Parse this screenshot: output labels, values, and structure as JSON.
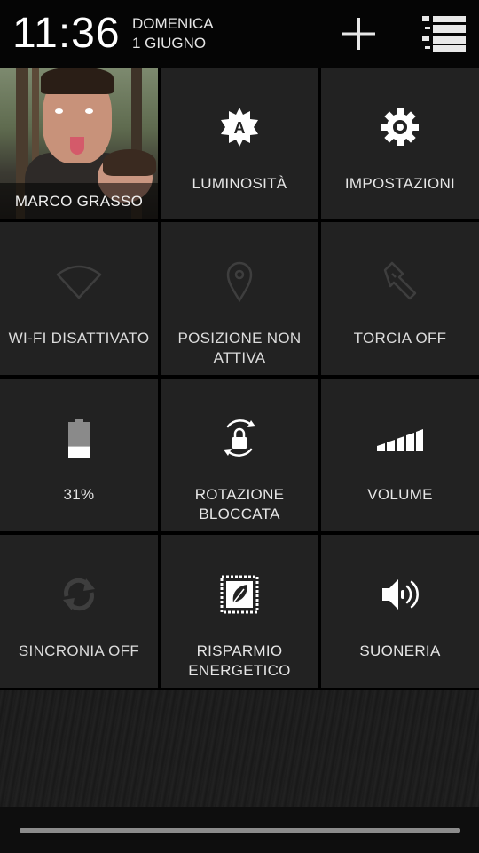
{
  "status": {
    "time": "11:36",
    "day": "DOMENICA",
    "date": "1 GIUGNO"
  },
  "header": {
    "add_icon": "plus-icon",
    "list_icon": "settings-list-icon"
  },
  "tiles": [
    {
      "label": "MARCO GRASSO",
      "icon": "user-photo",
      "state": "on"
    },
    {
      "label": "LUMINOSITÀ",
      "icon": "brightness-auto-icon",
      "state": "on"
    },
    {
      "label": "IMPOSTAZIONI",
      "icon": "gear-icon",
      "state": "on"
    },
    {
      "label": "WI-FI DISATTIVATO",
      "icon": "wifi-icon",
      "state": "off"
    },
    {
      "label": "POSIZIONE NON ATTIVA",
      "icon": "location-pin-icon",
      "state": "off"
    },
    {
      "label": "TORCIA OFF",
      "icon": "flashlight-icon",
      "state": "off"
    },
    {
      "label": "31%",
      "icon": "battery-icon",
      "state": "on",
      "level": 0.31
    },
    {
      "label": "ROTAZIONE BLOCCATA",
      "icon": "rotation-lock-icon",
      "state": "on"
    },
    {
      "label": "VOLUME",
      "icon": "volume-bars-icon",
      "state": "on"
    },
    {
      "label": "SINCRONIA OFF",
      "icon": "sync-icon",
      "state": "off"
    },
    {
      "label": "RISPARMIO ENERGETICO",
      "icon": "power-saver-chip-icon",
      "state": "on"
    },
    {
      "label": "SUONERIA",
      "icon": "ringer-speaker-icon",
      "state": "on"
    }
  ]
}
